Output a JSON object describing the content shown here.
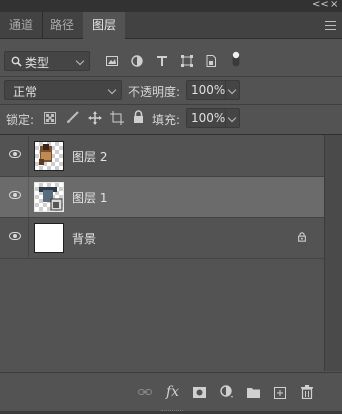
{
  "panel": {
    "tabs": [
      {
        "label": "通道",
        "active": false
      },
      {
        "label": "路径",
        "active": false
      },
      {
        "label": "图层",
        "active": true
      }
    ],
    "window_controls": {
      "collapse": "<<",
      "close": "×"
    }
  },
  "filter": {
    "kind_label": "类型",
    "icons": [
      "image-filter-icon",
      "adjustment-filter-icon",
      "text-filter-icon",
      "shape-filter-icon",
      "smart-object-filter-icon",
      "toggle-filter-icon"
    ]
  },
  "blend": {
    "mode": "正常",
    "opacity_label": "不透明度:",
    "opacity_value": "100%"
  },
  "lock": {
    "label": "锁定:",
    "fill_label": "填充:",
    "fill_value": "100%",
    "icons": [
      "lock-transparent-icon",
      "lock-image-icon",
      "lock-position-icon",
      "lock-artboard-icon",
      "lock-all-icon"
    ]
  },
  "layers": [
    {
      "name": "图层 2",
      "visible": true,
      "selected": false,
      "thumb": "figure"
    },
    {
      "name": "图层 1",
      "visible": true,
      "selected": true,
      "thumb": "smart-object"
    },
    {
      "name": "背景",
      "visible": true,
      "selected": false,
      "thumb": "white",
      "locked": true
    }
  ],
  "bottom_icons": [
    "link-layers-icon",
    "fx-icon",
    "add-mask-icon",
    "adjustment-layer-icon",
    "new-group-icon",
    "new-layer-icon",
    "delete-icon"
  ],
  "bottom": {
    "fx_label": "fx"
  }
}
